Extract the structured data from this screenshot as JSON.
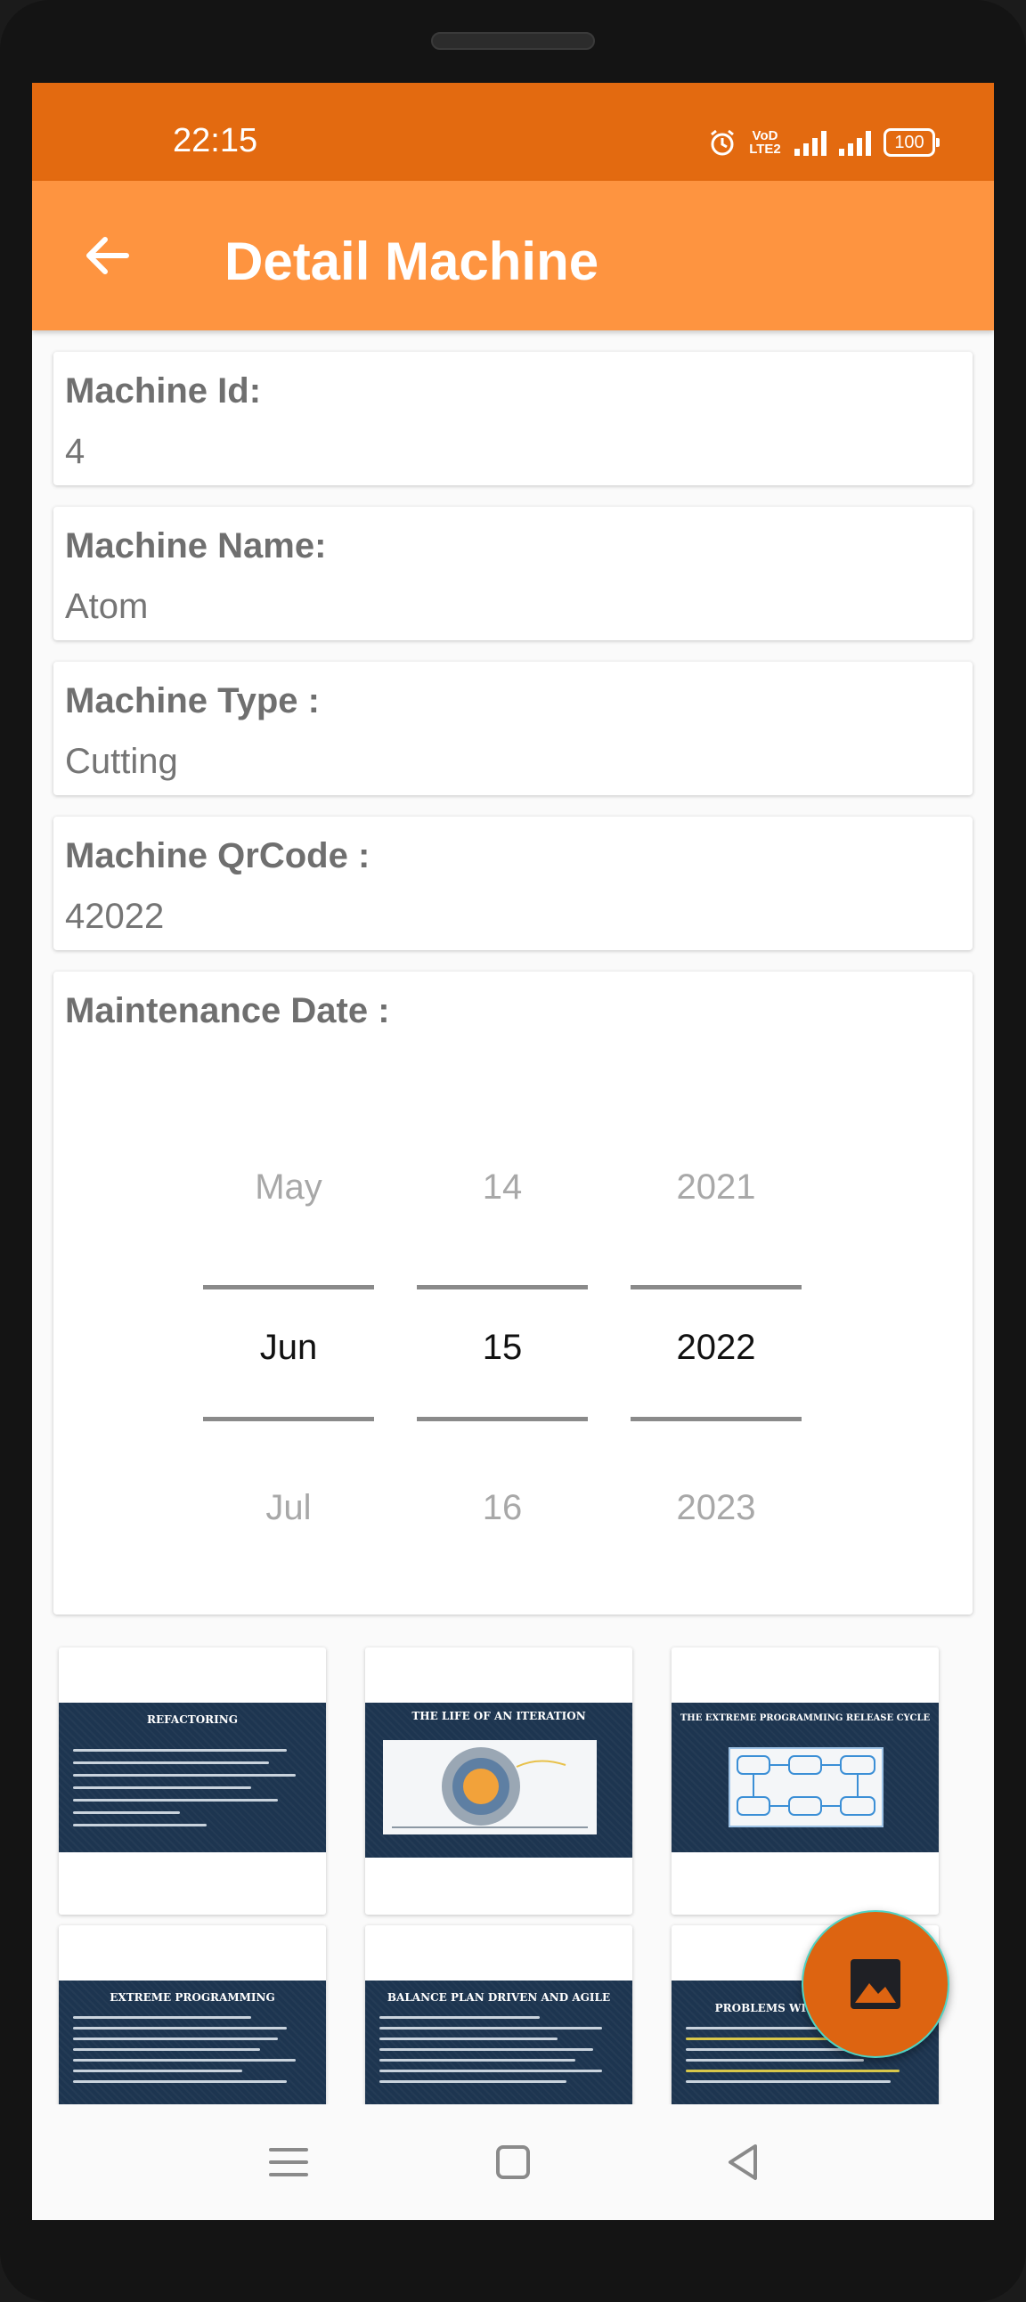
{
  "status_bar": {
    "time": "22:15",
    "volte_line1": "VoD",
    "volte_line2": "LTE2",
    "battery": "100"
  },
  "app_bar": {
    "title": "Detail Machine"
  },
  "fields": [
    {
      "label": "Machine Id:",
      "value": "4"
    },
    {
      "label": "Machine Name:",
      "value": "Atom"
    },
    {
      "label": "Machine Type :",
      "value": "Cutting"
    },
    {
      "label": "Machine QrCode :",
      "value": "42022"
    }
  ],
  "maintenance": {
    "label": "Maintenance Date :",
    "month": {
      "prev": "May",
      "selected": "Jun",
      "next": "Jul"
    },
    "day": {
      "prev": "14",
      "selected": "15",
      "next": "16"
    },
    "year": {
      "prev": "2021",
      "selected": "2022",
      "next": "2023"
    }
  },
  "gallery": [
    {
      "title": "REFACTORING"
    },
    {
      "title": "THE LIFE OF AN ITERATION"
    },
    {
      "title": "THE EXTREME PROGRAMMING RELEASE CYCLE"
    },
    {
      "title": "EXTREME PROGRAMMING"
    },
    {
      "title": "BALANCE PLAN DRIVEN AND AGILE"
    },
    {
      "title": "PROBLEMS WITH"
    }
  ],
  "colors": {
    "status_bar": "#e36a10",
    "app_bar": "#fe9440",
    "fab": "#dd6411",
    "fab_border": "#4fd3c4"
  },
  "icons": {
    "back": "arrow-left-icon",
    "fab": "image-icon",
    "nav": [
      "menu-icon",
      "home-icon",
      "back-triangle-icon"
    ]
  }
}
